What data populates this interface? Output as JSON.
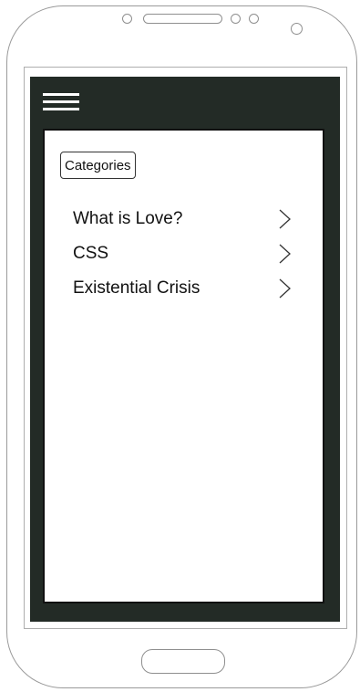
{
  "header": {
    "menu_icon": "hamburger-menu-icon"
  },
  "categories_button": {
    "label": "Categories"
  },
  "list": {
    "items": [
      {
        "label": "What is Love?",
        "icon": "chevron-right-icon"
      },
      {
        "label": "CSS",
        "icon": "chevron-right-icon"
      },
      {
        "label": "Existential Crisis",
        "icon": "chevron-right-icon"
      }
    ]
  },
  "colors": {
    "app_background": "#232b26",
    "content_background": "#ffffff",
    "text": "#111111",
    "device_outline": "#9a9a9a"
  }
}
